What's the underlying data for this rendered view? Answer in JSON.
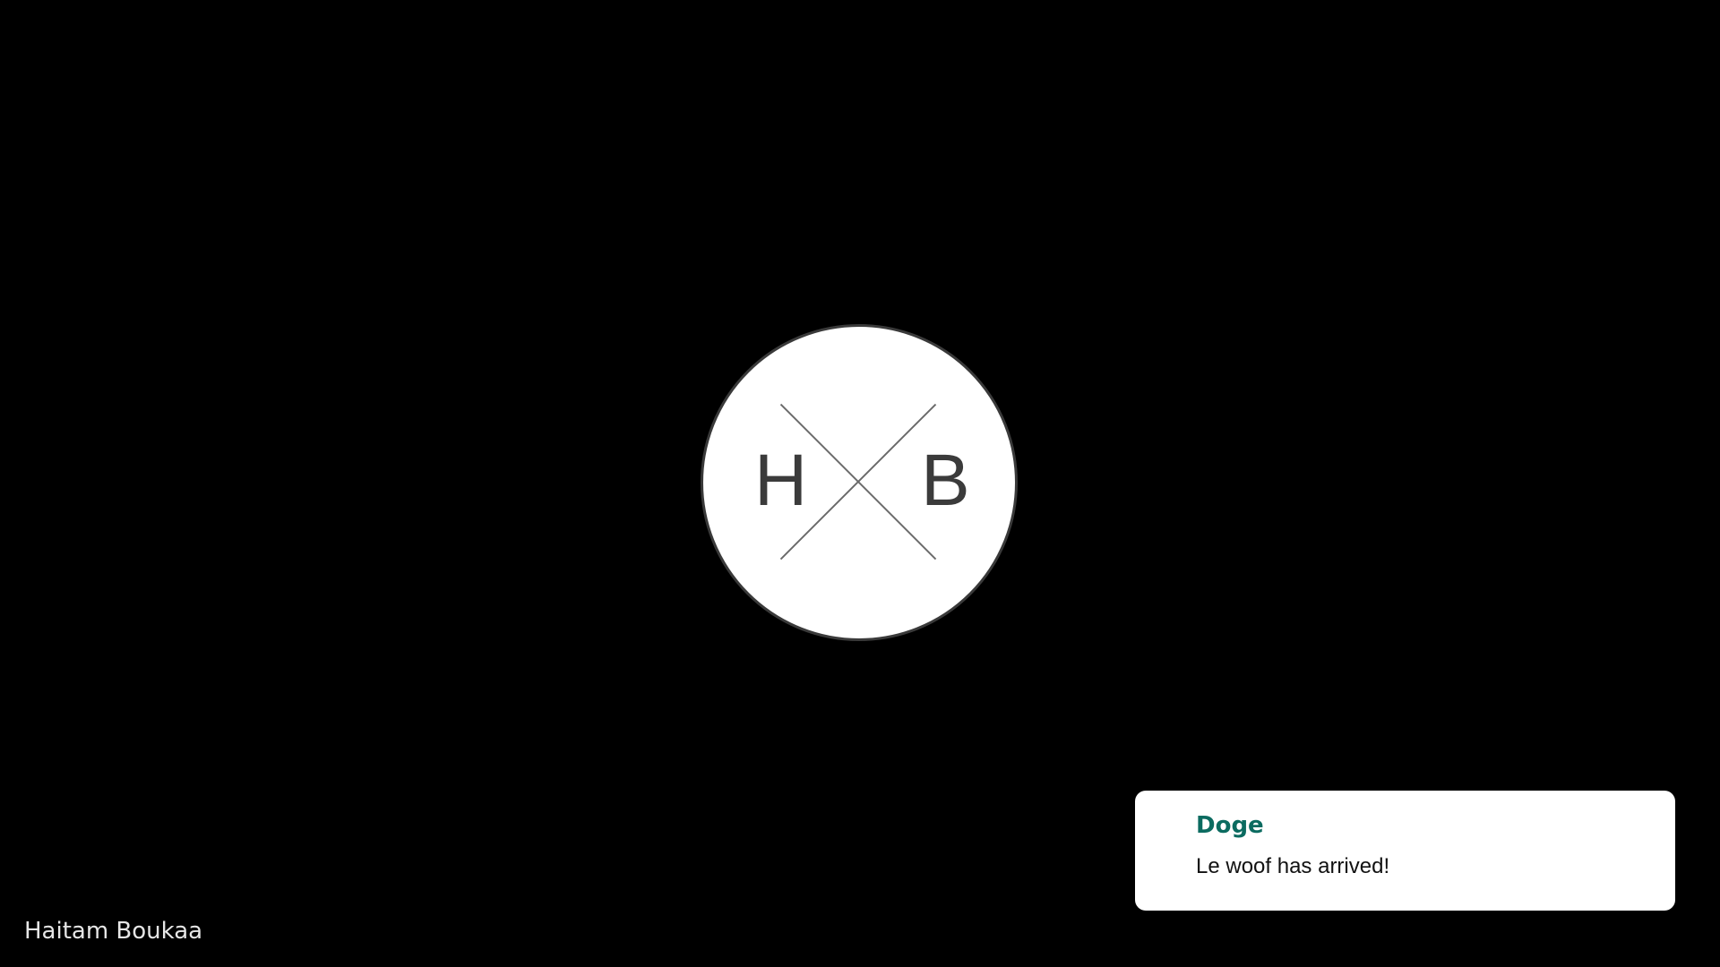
{
  "logo": {
    "left_letter": "H",
    "right_letter": "B"
  },
  "footer": {
    "author": "Haitam Boukaa"
  },
  "notification": {
    "title": "Doge",
    "message": "Le woof has arrived!",
    "title_color": "#0b6b60"
  },
  "colors": {
    "background": "#000000",
    "card": "#ffffff"
  }
}
